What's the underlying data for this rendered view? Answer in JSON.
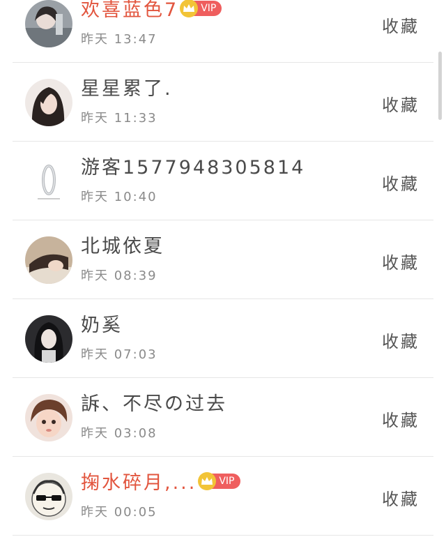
{
  "list": {
    "items": [
      {
        "name": "欢喜蓝色7",
        "vip": true,
        "time": "昨天 13:47",
        "action": "收藏"
      },
      {
        "name": "星星累了.",
        "vip": false,
        "time": "昨天 11:33",
        "action": "收藏"
      },
      {
        "name": "游客1577948305814",
        "vip": false,
        "time": "昨天 10:40",
        "action": "收藏"
      },
      {
        "name": "北城依夏",
        "vip": false,
        "time": "昨天 08:39",
        "action": "收藏"
      },
      {
        "name": "奶奚",
        "vip": false,
        "time": "昨天 07:03",
        "action": "收藏"
      },
      {
        "name": "訴、不尽の过去",
        "vip": false,
        "time": "昨天 03:08",
        "action": "收藏"
      },
      {
        "name": "掬水碎月,...",
        "vip": true,
        "time": "昨天 00:05",
        "action": "收藏"
      }
    ],
    "vip_label": "VIP"
  },
  "icons": {
    "vip_crown": "crown-icon"
  },
  "colors": {
    "vip_name": "#e2553e",
    "vip_badge": "#ef5e5e",
    "crown": "#f2c437",
    "normal_name": "#4a4a4a",
    "time": "#8a8a8a"
  }
}
